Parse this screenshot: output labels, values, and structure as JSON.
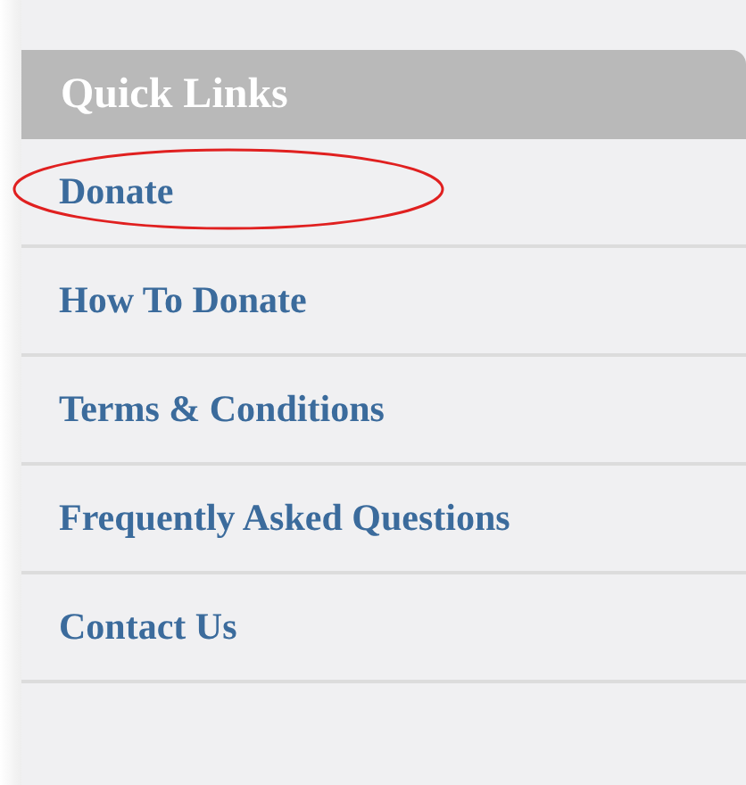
{
  "panel": {
    "title": "Quick Links"
  },
  "links": [
    {
      "label": "Donate",
      "circled": true
    },
    {
      "label": "How To Donate",
      "circled": false
    },
    {
      "label": "Terms & Conditions",
      "circled": false
    },
    {
      "label": "Frequently Asked Questions",
      "circled": false
    },
    {
      "label": "Contact Us",
      "circled": false
    }
  ]
}
